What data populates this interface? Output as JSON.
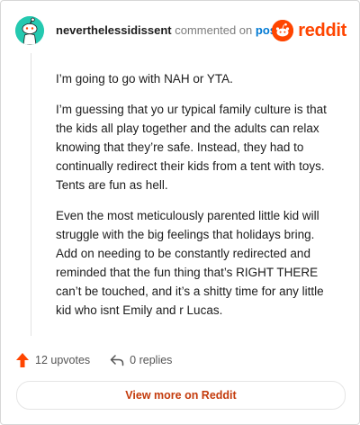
{
  "header": {
    "username": "neverthelessidissent",
    "commented_on": "commented on",
    "post_link": "post",
    "brand": "reddit"
  },
  "comment": {
    "paragraphs": [
      "I’m going to go with NAH or YTA.",
      "I’m guessing that yo ur typical family culture is that the kids all play together and the adults can relax knowing that they’re safe. Instead, they had to continually redirect their kids from a tent with toys. Tents are fun as hell.",
      "Even the most meticulously parented little kid will struggle with the big feelings that holidays bring. Add on needing to be constantly redirected and reminded that the fun thing that’s RIGHT THERE can’t be touched, and it’s a shitty time for any little kid who isnt Emily and r Lucas."
    ]
  },
  "actions": {
    "upvotes": "12 upvotes",
    "replies": "0 replies"
  },
  "footer": {
    "view_more": "View more on Reddit"
  },
  "colors": {
    "brand": "#ff4500",
    "link": "#0079d3",
    "avatar_bg": "#24c9b0",
    "view_more_text": "#c43b0c"
  },
  "icons": {
    "avatar": "snoo-avatar-icon",
    "logo": "reddit-snoo-icon",
    "upvote": "upvote-arrow-icon",
    "reply": "reply-arrow-icon"
  }
}
